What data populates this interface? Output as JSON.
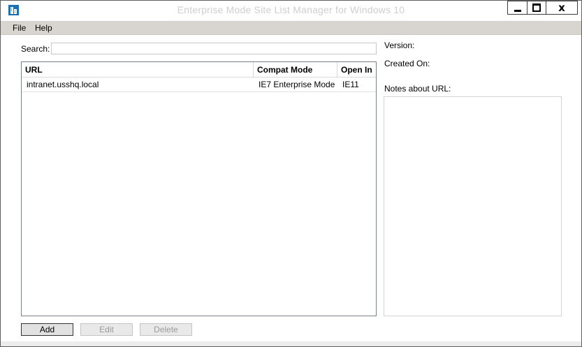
{
  "window": {
    "title": "Enterprise Mode Site List Manager for Windows 10",
    "minimize_label": "",
    "maximize_label": "",
    "close_label": "x"
  },
  "menu": {
    "file": "File",
    "help": "Help"
  },
  "search": {
    "label": "Search:",
    "value": "",
    "placeholder": ""
  },
  "list": {
    "columns": [
      "URL",
      "Compat Mode",
      "Open In"
    ],
    "rows": [
      {
        "url": "intranet.usshq.local",
        "compat_mode": "IE7 Enterprise Mode",
        "open_in": "IE11"
      }
    ]
  },
  "details": {
    "version_label": "Version:",
    "created_label": "Created On:",
    "notes_label": "Notes about URL:",
    "notes_value": ""
  },
  "buttons": {
    "add": "Add",
    "edit": "Edit",
    "delete": "Delete"
  },
  "icons": {
    "app": "building-icon",
    "minimize": "minimize-icon",
    "maximize": "maximize-icon",
    "close": "close-icon"
  },
  "colors": {
    "menubar_bg": "#d8d4cf",
    "app_icon": "#1f6fb5",
    "disabled_text": "#9a9a9a"
  }
}
